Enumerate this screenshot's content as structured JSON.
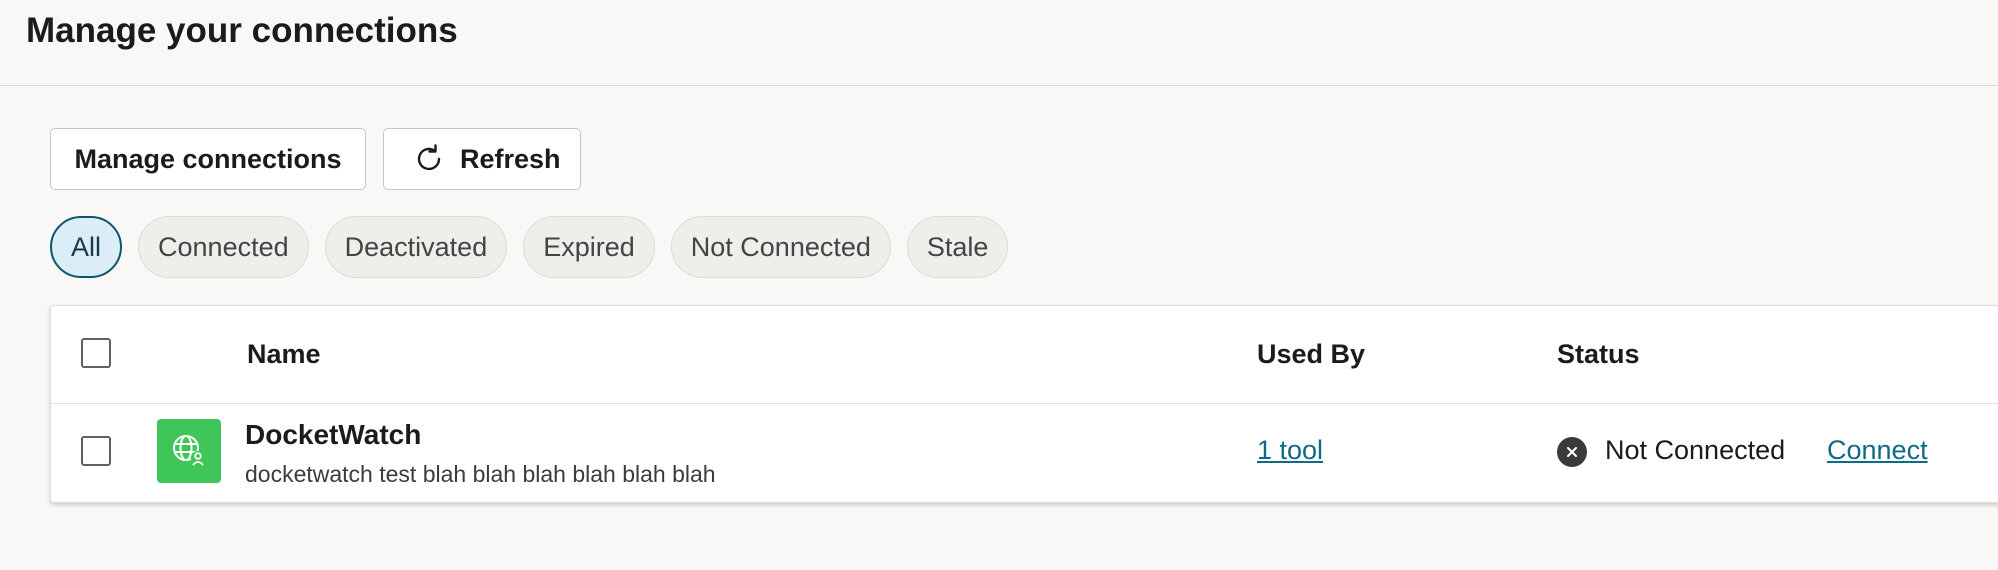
{
  "page": {
    "title": "Manage your connections"
  },
  "toolbar": {
    "manage_label": "Manage connections",
    "refresh_label": "Refresh",
    "refresh_icon": "refresh-icon"
  },
  "filters": [
    {
      "label": "All",
      "active": true
    },
    {
      "label": "Connected",
      "active": false
    },
    {
      "label": "Deactivated",
      "active": false
    },
    {
      "label": "Expired",
      "active": false
    },
    {
      "label": "Not Connected",
      "active": false
    },
    {
      "label": "Stale",
      "active": false
    }
  ],
  "table": {
    "columns": {
      "name": "Name",
      "used_by": "Used By",
      "status": "Status"
    },
    "rows": [
      {
        "icon": "globe-user-icon",
        "name": "DocketWatch",
        "description": "docketwatch test blah blah blah blah blah blah",
        "used_by": "1 tool",
        "status": "Not Connected",
        "status_icon": "error-circle-icon",
        "action": "Connect"
      }
    ]
  },
  "colors": {
    "accent": "#0f6a87",
    "active_pill_bg": "#dbeef8",
    "active_pill_border": "#0f5469",
    "app_icon_bg": "#3fc659",
    "background": "#f9f8f6"
  }
}
